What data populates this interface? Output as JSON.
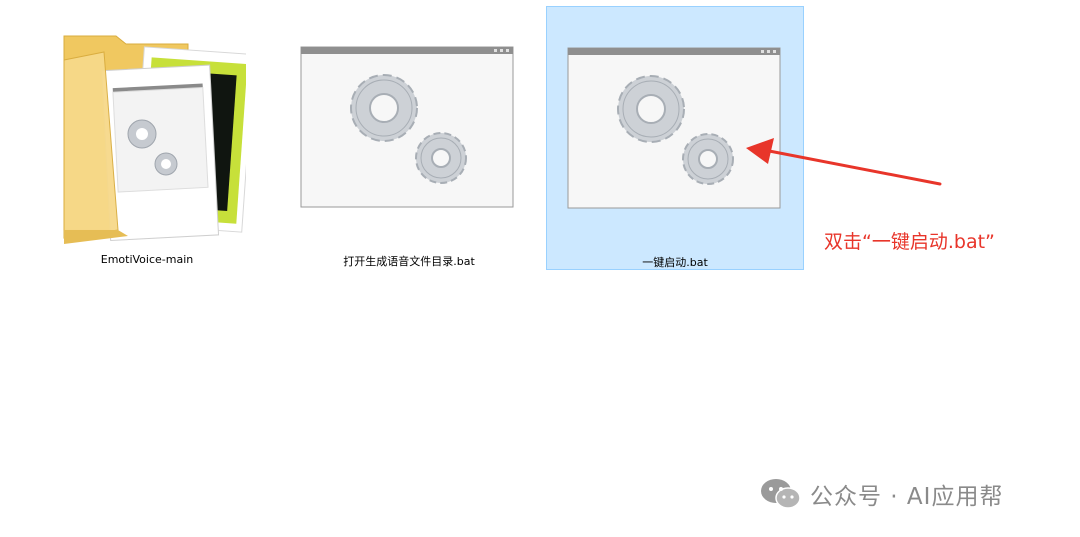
{
  "files": [
    {
      "label": "EmotiVoice-main",
      "icon": "folder-icon"
    },
    {
      "label": "打开生成语音文件目录.bat",
      "icon": "batch-file-icon"
    },
    {
      "label": "一键启动.bat",
      "icon": "batch-file-icon"
    }
  ],
  "annotation": {
    "text": "双击“一键启动.bat”",
    "color": "#e8352a"
  },
  "watermark": {
    "text": "公众号 · AI应用帮",
    "icon": "wechat-icon"
  },
  "colors": {
    "selection_bg": "#cce8ff",
    "selection_border": "#99d1ff",
    "folder": "#f5d27a",
    "gear": "#c9cdd2"
  }
}
